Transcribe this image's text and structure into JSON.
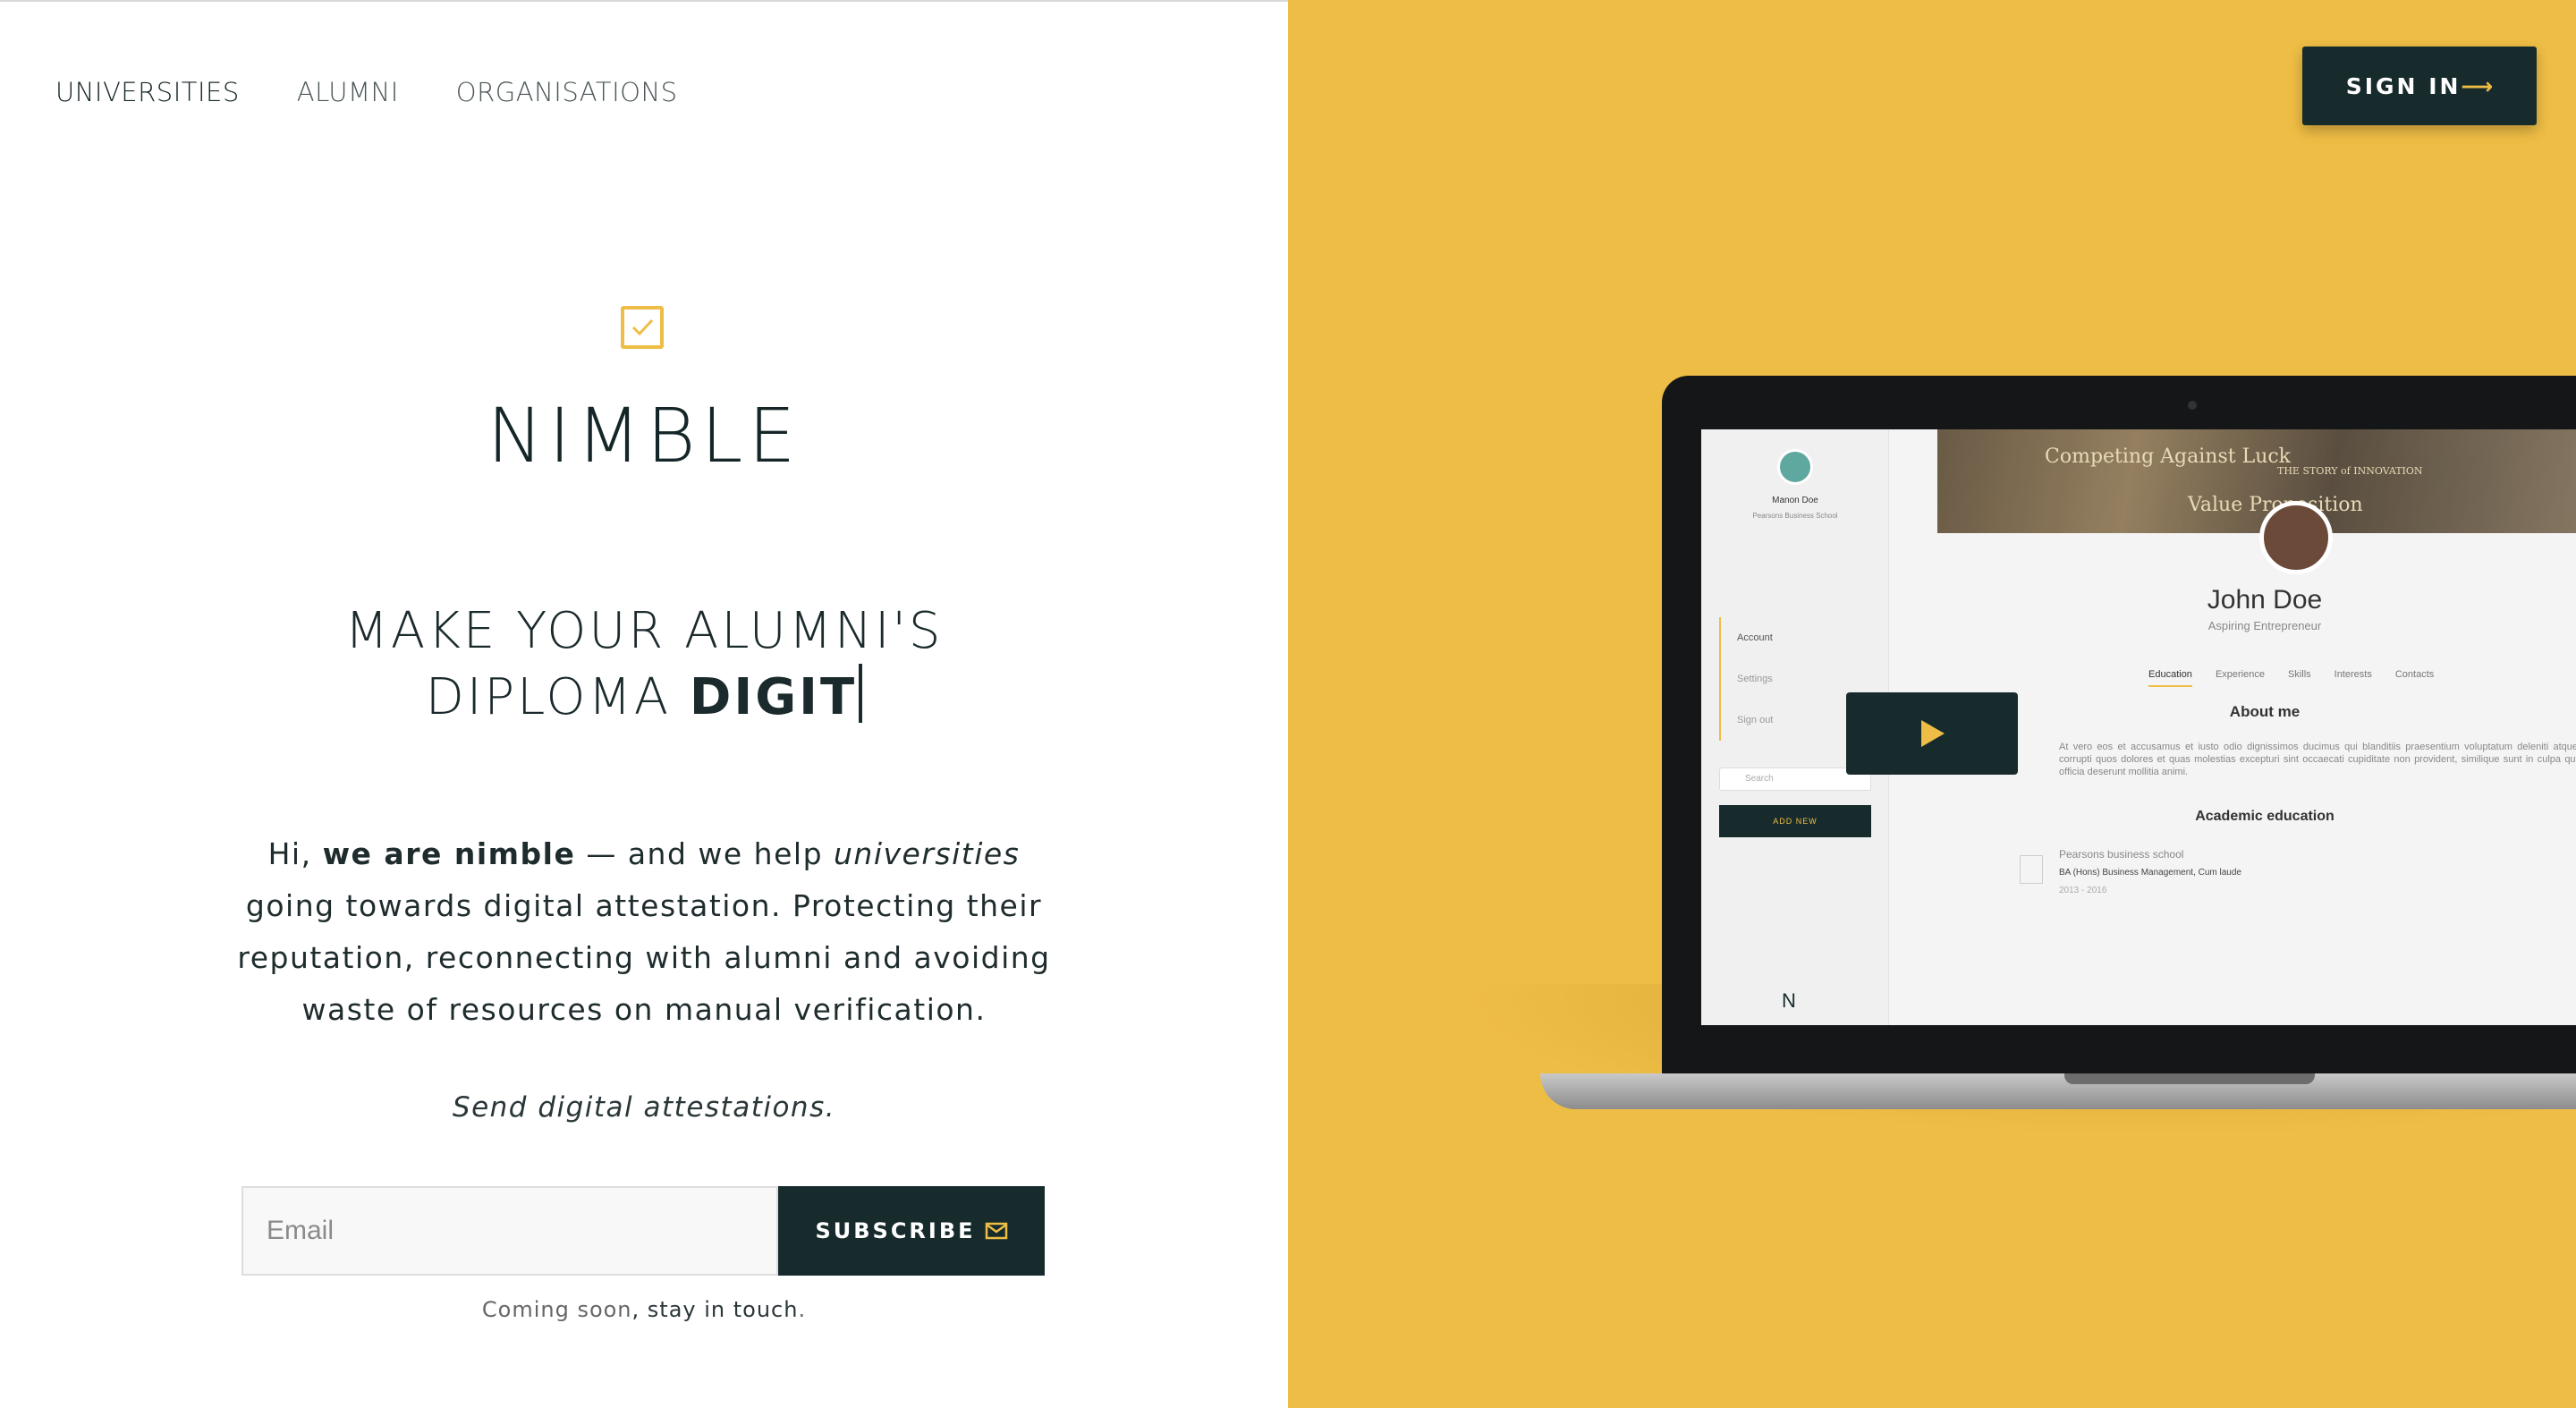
{
  "nav": {
    "items": [
      "UNIVERSITIES",
      "ALUMNI",
      "ORGANISATIONS"
    ],
    "active": "UNIVERSITIES"
  },
  "header": {
    "signin_label": "SIGN IN",
    "signin_arrow": "⟶"
  },
  "brand": {
    "name": "NIMBLE",
    "check_icon": "check-square-icon",
    "accent_color": "#eebd45",
    "dark_color": "#172b2d"
  },
  "hero": {
    "headline_line1": "MAKE YOUR ALUMNI'S",
    "headline_line2_regular": "DIPLOMA ",
    "headline_line2_bold": "DIGIT"
  },
  "intro": {
    "part1": "Hi, ",
    "bold": "we are nimble",
    "part2": " — and we help ",
    "italic": "universities",
    "part3": " going towards digital attestation. Protecting their reputation, reconnecting with alumni and avoiding waste of resources on manual verification."
  },
  "tagline": "Send digital attestations.",
  "subscribe": {
    "email_placeholder": "Email",
    "button_label": "SUBSCRIBE",
    "button_icon": "envelope-icon"
  },
  "note": {
    "part1": "Coming soon",
    "part2": ", stay in touch",
    "part3": "."
  },
  "mockup": {
    "sidebar_user": "Manon Doe",
    "sidebar_school": "Pearsons Business School",
    "menu": [
      "Account",
      "Settings",
      "Sign out"
    ],
    "search_placeholder": "Search",
    "add_new": "ADD NEW",
    "cover_texts": [
      "Competing Against Luck",
      "Value Proposition",
      "THE STORY of INNOVATION"
    ],
    "profile_name": "John Doe",
    "profile_role": "Aspiring Entrepreneur",
    "tabs": [
      "Education",
      "Experience",
      "Skills",
      "Interests",
      "Contacts"
    ],
    "about_title": "About me",
    "about_text": "At vero eos et accusamus et iusto odio dignissimos ducimus qui blanditiis praesentium voluptatum deleniti atque corrupti quos dolores et quas molestias excepturi sint occaecati cupiditate non provident, similique sunt in culpa qui officia deserunt mollitia animi.",
    "education_title": "Academic education",
    "edu_school": "Pearsons business school",
    "edu_degree": "BA (Hons) Business Management,  Cum laude",
    "edu_years": "2013 - 2016",
    "mini_logo": "N"
  }
}
